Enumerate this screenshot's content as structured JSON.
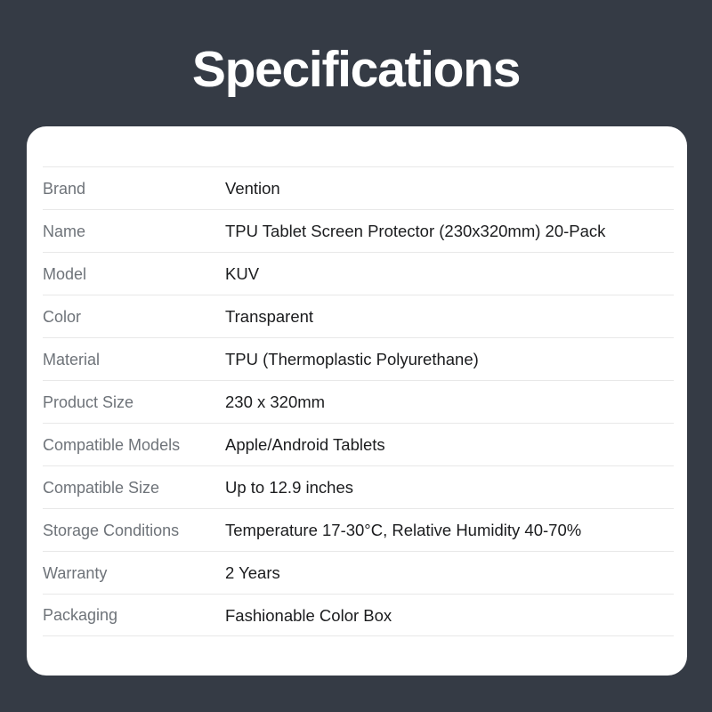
{
  "page": {
    "title": "Specifications",
    "background_color": "#353b45",
    "card_background_color": "#ffffff",
    "label_color": "#6e7379",
    "value_color": "#1b1c1e",
    "divider_color": "#e8e8e8"
  },
  "spec_table": {
    "rows": [
      {
        "label": "Brand",
        "value": "Vention"
      },
      {
        "label": "Name",
        "value": "TPU Tablet Screen Protector (230x320mm) 20-Pack"
      },
      {
        "label": "Model",
        "value": "KUV"
      },
      {
        "label": "Color",
        "value": "Transparent"
      },
      {
        "label": "Material",
        "value": "TPU (Thermoplastic Polyurethane)"
      },
      {
        "label": "Product Size",
        "value": "230 x 320mm"
      },
      {
        "label": "Compatible Models",
        "value": "Apple/Android Tablets"
      },
      {
        "label": "Compatible Size",
        "value": "Up to 12.9 inches"
      },
      {
        "label": "Storage Conditions",
        "value": "Temperature 17-30°C, Relative Humidity 40-70%"
      },
      {
        "label": "Warranty",
        "value": "2 Years"
      },
      {
        "label": "Packaging",
        "value": "Fashionable Color Box"
      }
    ]
  }
}
